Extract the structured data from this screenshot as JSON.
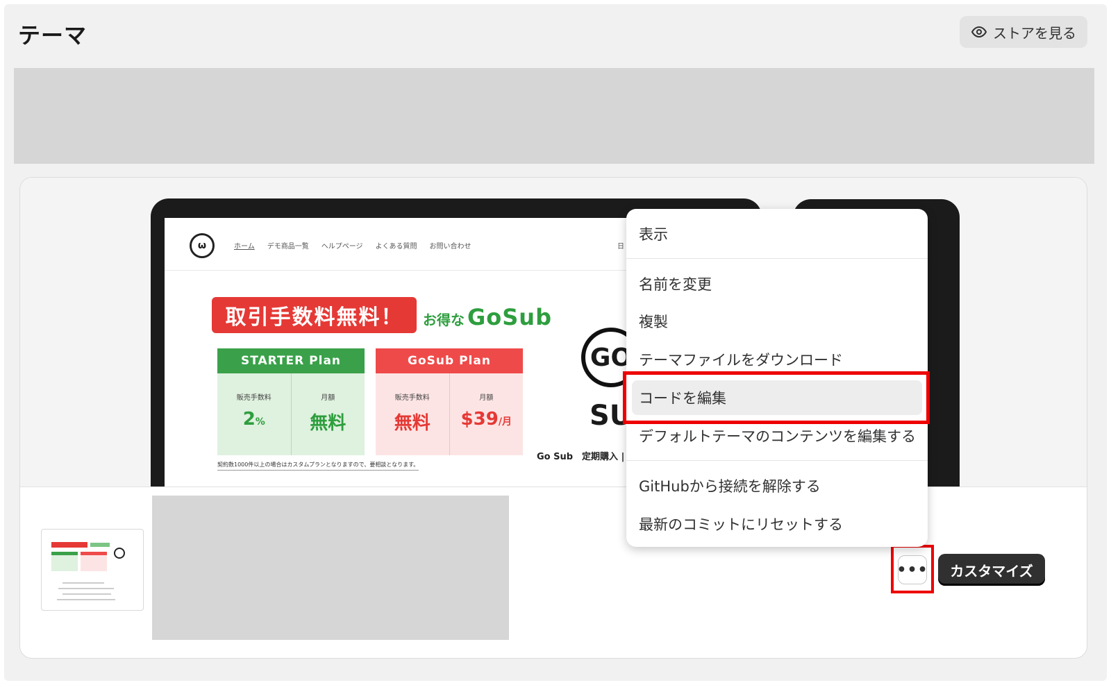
{
  "header": {
    "title": "テーマ",
    "store_button_label": "ストアを見る"
  },
  "preview": {
    "site_logo": "ω",
    "nav": [
      "ホーム",
      "デモ商品一覧",
      "ヘルプページ",
      "よくある質問",
      "お問い合わせ"
    ],
    "nav_right": "日",
    "promo_badge": "取引手数料無料！",
    "promo_sub_prefix": "お得な",
    "promo_sub_brand": "GoSub",
    "plans": [
      {
        "name": "STARTER Plan",
        "fee_label": "販売手数料",
        "fee_value": "2",
        "fee_unit": "%",
        "monthly_label": "月額",
        "monthly_value": "無料",
        "monthly_unit": ""
      },
      {
        "name": "GoSub Plan",
        "fee_label": "販売手数料",
        "fee_value": "無料",
        "fee_unit": "",
        "monthly_label": "月額",
        "monthly_value": "$39",
        "monthly_unit": "/月"
      }
    ],
    "note": "契約数1000件以上の場合はカスタムプランとなりますので、要相談となります。",
    "go_logo_top": "GO",
    "go_logo_bottom": "SU",
    "go_bottom_text": "Go Sub　定期購入 |"
  },
  "actions": {
    "more_label": "•••",
    "customize_label": "カスタマイズ"
  },
  "menu": {
    "items": [
      "表示",
      "名前を変更",
      "複製",
      "テーマファイルをダウンロード",
      "コードを編集",
      "デフォルトテーマのコンテンツを編集する",
      "GitHubから接続を解除する",
      "最新のコミットにリセットする"
    ],
    "active_index": 4
  },
  "colors": {
    "highlight": "#ee0000",
    "primary_button": "#303030",
    "promo_red": "#e53935",
    "promo_green": "#3aa14a"
  }
}
